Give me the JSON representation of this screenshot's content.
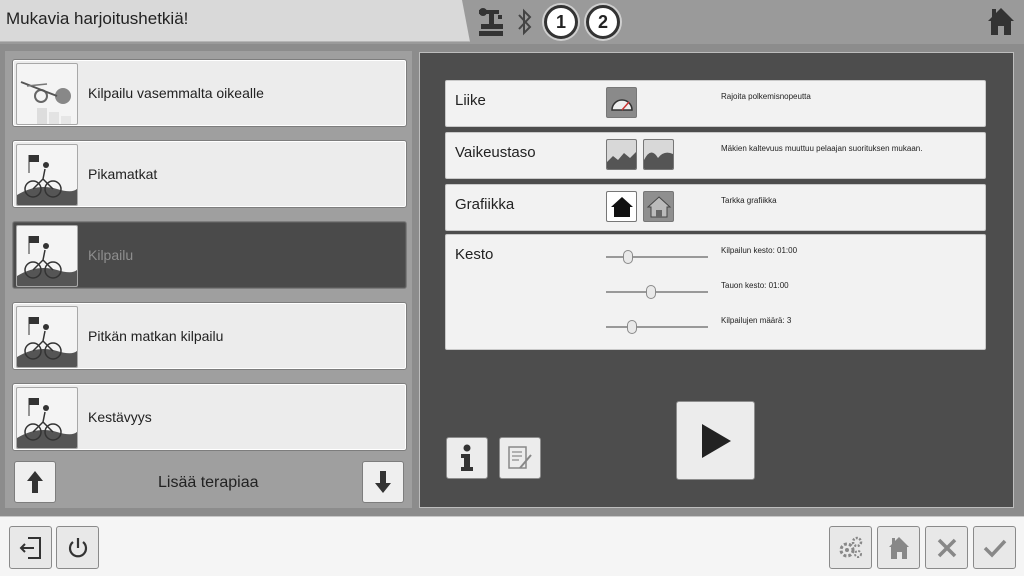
{
  "header": {
    "title": "Mukavia harjoitushetkiä!",
    "indicators": [
      {
        "icon": "bike-stand-icon"
      },
      {
        "icon": "bluetooth-icon"
      },
      {
        "icon": "user-1-icon",
        "label": "1"
      },
      {
        "icon": "user-2-icon",
        "label": "2"
      }
    ],
    "home_icon": "home-icon"
  },
  "programs": {
    "items": [
      {
        "label": "Kilpailu vasemmalta oikealle",
        "thumb": "race-left-right-icon",
        "selected": false
      },
      {
        "label": "Pikamatkat",
        "thumb": "cyclist-icon",
        "selected": false
      },
      {
        "label": "Kilpailu",
        "thumb": "cyclist-icon",
        "selected": true
      },
      {
        "label": "Pitkän matkan kilpailu",
        "thumb": "cyclist-icon",
        "selected": false
      },
      {
        "label": "Kestävyys",
        "thumb": "cyclist-icon",
        "selected": false
      }
    ],
    "more_label": "Lisää terapiaa",
    "up_icon": "arrow-up-icon",
    "down_icon": "arrow-down-icon"
  },
  "settings": {
    "liike": {
      "title": "Liike",
      "description": "Rajoita polkemisnopeutta",
      "icon": "speedometer-icon"
    },
    "vaikeustaso": {
      "title": "Vaikeustaso",
      "description": "Mäkien kaltevuus muuttuu pelaajan suorituksen mukaan.",
      "icons": [
        "hills-flat-icon",
        "hills-steep-icon"
      ]
    },
    "grafiikka": {
      "title": "Grafiikka",
      "description": "Tarkka grafiikka",
      "icons": [
        "house-simple-icon",
        "house-detailed-icon"
      ],
      "selected_index": 0
    },
    "kesto": {
      "title": "Kesto",
      "sliders": [
        {
          "label": "Kilpailun kesto: 01:00",
          "level": 0.18
        },
        {
          "label": "Tauon kesto: 01:00",
          "level": 0.43
        },
        {
          "label": "Kilpailujen määrä: 3",
          "level": 0.23
        }
      ]
    }
  },
  "actions": {
    "info_icon": "info-icon",
    "edit_icon": "edit-notes-icon",
    "play_icon": "play-icon"
  },
  "footer": {
    "left": [
      "logout-icon",
      "power-icon"
    ],
    "right": [
      "settings-gears-icon",
      "home-settings-icon",
      "cancel-icon",
      "confirm-icon"
    ]
  },
  "colors": {
    "background": "#8c8c8c",
    "panel_dark": "#4d4d4d",
    "selected_item": "#4a4a4a",
    "row_bg": "#f2f2f2"
  }
}
